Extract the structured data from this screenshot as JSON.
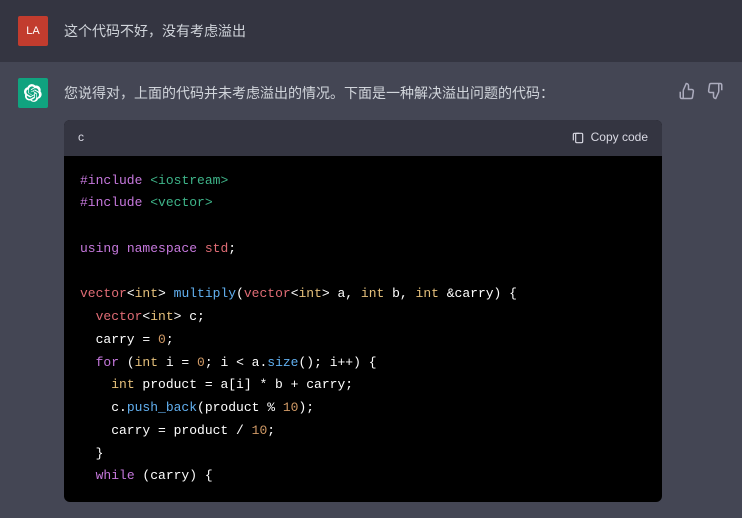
{
  "user": {
    "avatar_text": "LA",
    "message": "这个代码不好，没有考虑溢出"
  },
  "assistant": {
    "message": "您说得对，上面的代码并未考虑溢出的情况。下面是一种解决溢出问题的代码：",
    "code": {
      "language": "c",
      "copy_label": "Copy code",
      "tokens": [
        {
          "t": "c-pp",
          "v": "#include"
        },
        {
          "t": "",
          "v": " "
        },
        {
          "t": "c-str",
          "v": "<iostream>"
        },
        {
          "t": "",
          "v": "\n"
        },
        {
          "t": "c-pp",
          "v": "#include"
        },
        {
          "t": "",
          "v": " "
        },
        {
          "t": "c-str",
          "v": "<vector>"
        },
        {
          "t": "",
          "v": "\n\n"
        },
        {
          "t": "c-kw",
          "v": "using"
        },
        {
          "t": "",
          "v": " "
        },
        {
          "t": "c-kw",
          "v": "namespace"
        },
        {
          "t": "",
          "v": " "
        },
        {
          "t": "c-id",
          "v": "std"
        },
        {
          "t": "",
          "v": ";\n\n"
        },
        {
          "t": "c-id",
          "v": "vector"
        },
        {
          "t": "",
          "v": "<"
        },
        {
          "t": "c-type",
          "v": "int"
        },
        {
          "t": "",
          "v": "> "
        },
        {
          "t": "c-fn",
          "v": "multiply"
        },
        {
          "t": "",
          "v": "("
        },
        {
          "t": "c-id",
          "v": "vector"
        },
        {
          "t": "",
          "v": "<"
        },
        {
          "t": "c-type",
          "v": "int"
        },
        {
          "t": "",
          "v": "> a, "
        },
        {
          "t": "c-type",
          "v": "int"
        },
        {
          "t": "",
          "v": " b, "
        },
        {
          "t": "c-type",
          "v": "int"
        },
        {
          "t": "",
          "v": " &carry) {\n"
        },
        {
          "t": "",
          "v": "  "
        },
        {
          "t": "c-id",
          "v": "vector"
        },
        {
          "t": "",
          "v": "<"
        },
        {
          "t": "c-type",
          "v": "int"
        },
        {
          "t": "",
          "v": "> c;\n"
        },
        {
          "t": "",
          "v": "  carry = "
        },
        {
          "t": "c-num",
          "v": "0"
        },
        {
          "t": "",
          "v": ";\n"
        },
        {
          "t": "",
          "v": "  "
        },
        {
          "t": "c-kw",
          "v": "for"
        },
        {
          "t": "",
          "v": " ("
        },
        {
          "t": "c-type",
          "v": "int"
        },
        {
          "t": "",
          "v": " i = "
        },
        {
          "t": "c-num",
          "v": "0"
        },
        {
          "t": "",
          "v": "; i < a."
        },
        {
          "t": "c-fn",
          "v": "size"
        },
        {
          "t": "",
          "v": "(); i++) {\n"
        },
        {
          "t": "",
          "v": "    "
        },
        {
          "t": "c-type",
          "v": "int"
        },
        {
          "t": "",
          "v": " product = a[i] * b + carry;\n"
        },
        {
          "t": "",
          "v": "    c."
        },
        {
          "t": "c-fn",
          "v": "push_back"
        },
        {
          "t": "",
          "v": "(product % "
        },
        {
          "t": "c-num",
          "v": "10"
        },
        {
          "t": "",
          "v": ");\n"
        },
        {
          "t": "",
          "v": "    carry = product / "
        },
        {
          "t": "c-num",
          "v": "10"
        },
        {
          "t": "",
          "v": ";\n"
        },
        {
          "t": "",
          "v": "  }\n"
        },
        {
          "t": "",
          "v": "  "
        },
        {
          "t": "c-kw",
          "v": "while"
        },
        {
          "t": "",
          "v": " (carry) {\n"
        }
      ]
    }
  }
}
